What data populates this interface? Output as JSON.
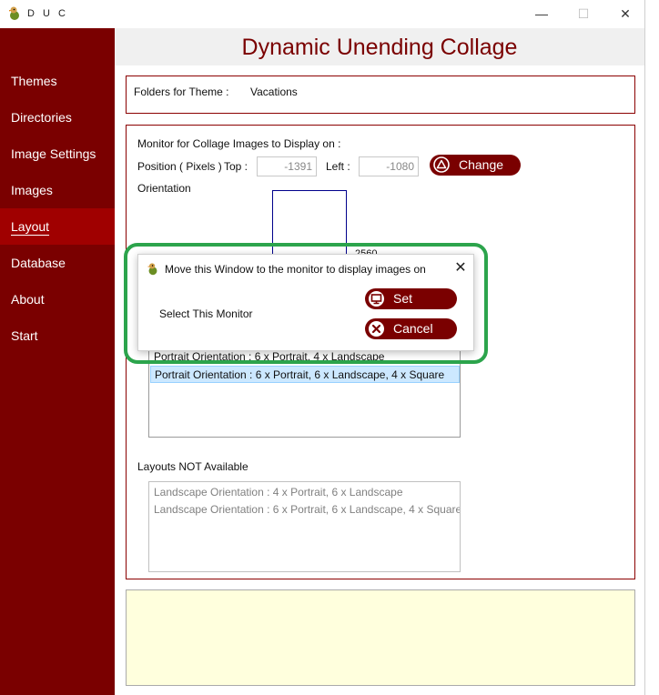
{
  "window": {
    "title": "D U C",
    "minimize": "—",
    "maximize": "☐",
    "close": "✕"
  },
  "sidebar": {
    "items": [
      {
        "label": "Themes"
      },
      {
        "label": "Directories"
      },
      {
        "label": "Image Settings"
      },
      {
        "label": "Images"
      },
      {
        "label": "Layout"
      },
      {
        "label": "Database"
      },
      {
        "label": "About"
      },
      {
        "label": "Start"
      }
    ],
    "active": "Layout"
  },
  "header": {
    "title": "Dynamic Unending Collage"
  },
  "theme_panel": {
    "label": "Folders for Theme :",
    "value": "Vacations"
  },
  "monitor_panel": {
    "heading": "Monitor for Collage Images to Display on :",
    "position_label": "Position ( Pixels )",
    "top_label": "Top :",
    "top_value": "-1391",
    "left_label": "Left :",
    "left_value": "-1080",
    "change_label": "Change",
    "orientation_label": "Orientation",
    "monitor_width": "2560"
  },
  "layouts_available": {
    "items": [
      "Portrait Orientation : 6 x Portrait, 4 x Landscape",
      "Portrait Orientation : 6 x Portrait, 6 x Landscape, 4 x Square"
    ],
    "selected_index": 1
  },
  "layouts_not_available": {
    "label": "Layouts NOT Available",
    "items": [
      "Landscape Orientation : 4 x Portrait, 6 x Landscape",
      "Landscape Orientation : 6 x Portrait, 6 x Landscape, 4 x Square"
    ]
  },
  "dialog": {
    "title": "Move this Window to the monitor to display images on",
    "close": "✕",
    "label": "Select This Monitor",
    "set_label": "Set",
    "cancel_label": "Cancel"
  },
  "colors": {
    "accent": "#7a0000",
    "active_nav": "#a00000",
    "highlight": "#2ca44c",
    "notes_bg": "#ffffdd"
  }
}
